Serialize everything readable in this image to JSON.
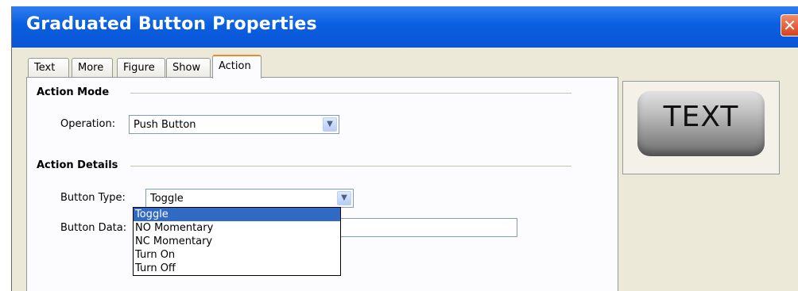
{
  "window": {
    "title": "Graduated Button Properties",
    "close_glyph": "✕"
  },
  "tabs": [
    {
      "label": "Text"
    },
    {
      "label": "More"
    },
    {
      "label": "Figure"
    },
    {
      "label": "Show"
    },
    {
      "label": "Action",
      "active": true
    }
  ],
  "action_mode": {
    "title": "Action Mode",
    "operation_label": "Operation:",
    "operation_value": "Push Button"
  },
  "action_details": {
    "title": "Action Details",
    "button_type_label": "Button Type:",
    "button_type_value": "Toggle",
    "button_data_label": "Button Data:",
    "button_data_value": ""
  },
  "dropdown": {
    "options": [
      "Toggle",
      "NO Momentary",
      "NC Momentary",
      "Turn On",
      "Turn Off"
    ],
    "selected_index": 0
  },
  "preview": {
    "button_text": "TEXT"
  },
  "icons": {
    "combo_arrow": "chevron-down-icon",
    "close": "close-icon"
  },
  "colors": {
    "title_bar": "#0a5fe0",
    "selection": "#316ac5",
    "active_tab_accent": "#e68b2c"
  }
}
